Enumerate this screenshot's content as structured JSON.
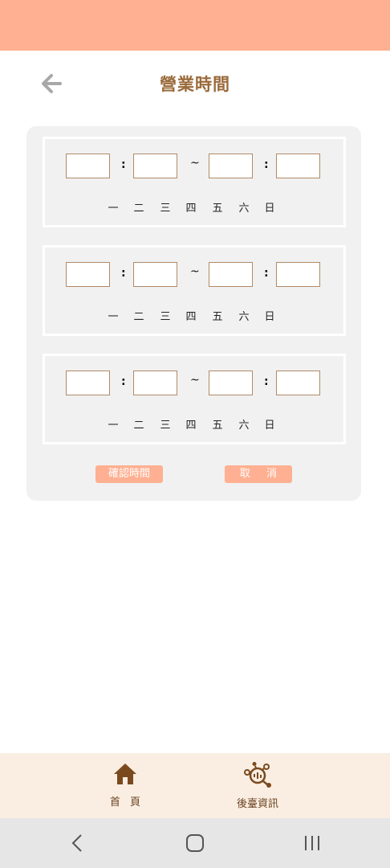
{
  "header": {
    "title": "營業時間"
  },
  "colors": {
    "accent": "#ffb092",
    "title": "#9a6a3a",
    "nav_bg": "#faeee2"
  },
  "time_slots": [
    {
      "colon": ":",
      "tilde": "~"
    },
    {
      "colon": ":",
      "tilde": "~"
    },
    {
      "colon": ":",
      "tilde": "~"
    }
  ],
  "weekdays": [
    "一",
    "二",
    "三",
    "四",
    "五",
    "六",
    "日"
  ],
  "actions": {
    "confirm_label": "確認時間",
    "cancel_label": "取 消"
  },
  "bottom_nav": {
    "home_label": "首 頁",
    "backend_label": "後臺資訊"
  },
  "icons": {
    "back": "arrow-left-icon",
    "home": "house-icon",
    "backend": "network-analytics-icon"
  }
}
